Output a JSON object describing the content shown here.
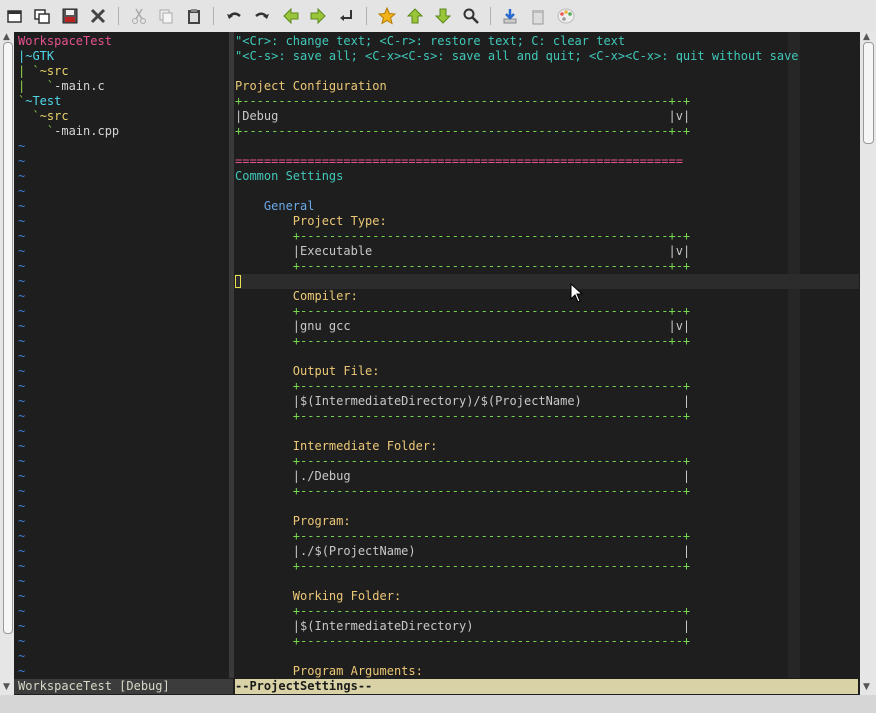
{
  "toolbar": {
    "buttons": [
      "open-workspace",
      "open-project",
      "save",
      "close",
      "cut",
      "copy",
      "paste",
      "undo",
      "redo",
      "back",
      "forward",
      "jump",
      "bookmark",
      "up",
      "down",
      "find",
      "download",
      "trash",
      "palette"
    ]
  },
  "tree": {
    "lines": [
      {
        "prefix": "",
        "text": "WorkspaceTest",
        "cls": "c-red"
      },
      {
        "prefix": "|",
        "text": "~GTK",
        "cls": "c-cyan"
      },
      {
        "prefix": "| `",
        "text": "~src",
        "cls": "c-yellow"
      },
      {
        "prefix": "|   `",
        "text": "-main.c",
        "cls": "c-white"
      },
      {
        "prefix": "`",
        "text": "~Test",
        "cls": "c-cyan"
      },
      {
        "prefix": "  `",
        "text": "~src",
        "cls": "c-yellow"
      },
      {
        "prefix": "    `",
        "text": "-main.cpp",
        "cls": "c-white"
      }
    ],
    "tilde": "~"
  },
  "help": {
    "line1": "\"<Cr>: change text; <C-r>: restore text; C: clear text",
    "line2": "\"<C-s>: save all; <C-x><C-s>: save all and quit; <C-x><C-x>: quit without save"
  },
  "settings": {
    "project_config_label": "Project Configuration",
    "project_config_value": "|Debug",
    "common_label": "Common Settings",
    "general_label": "General",
    "fields": [
      {
        "label": "Project Type:",
        "value": "|Executable",
        "combo": true
      },
      {
        "label": "Compiler:",
        "value": "|gnu gcc",
        "combo": true
      },
      {
        "label": "Output File:",
        "value": "|$(IntermediateDirectory)/$(ProjectName)",
        "combo": false
      },
      {
        "label": "Intermediate Folder:",
        "value": "|./Debug",
        "combo": false
      },
      {
        "label": "Program:",
        "value": "|./$(ProjectName)",
        "combo": false
      },
      {
        "label": "Working Folder:",
        "value": "|$(IntermediateDirectory)",
        "combo": false
      }
    ],
    "next_label": "Program Arguments:"
  },
  "status": {
    "left": "WorkspaceTest [Debug]",
    "right": "--ProjectSettings--"
  }
}
